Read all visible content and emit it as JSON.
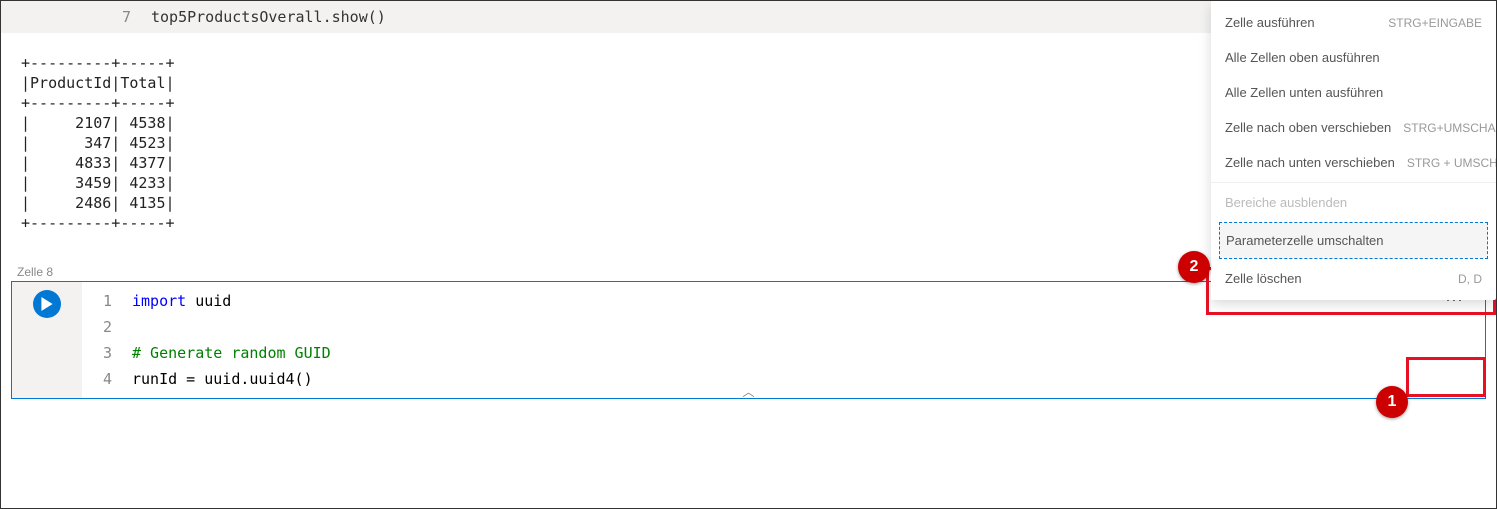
{
  "cell7": {
    "lineno": "7",
    "code": "top5ProductsOverall.show()"
  },
  "output_text": "+---------+-----+\n|ProductId|Total|\n+---------+-----+\n|     2107| 4538|\n|      347| 4523|\n|     4833| 4377|\n|     3459| 4233|\n|     2486| 4135|\n+---------+-----+",
  "cell8_label": "Zelle 8",
  "cell8": {
    "lines": [
      "1",
      "2",
      "3",
      "4"
    ],
    "l1_kw": "import",
    "l1_mod": " uuid",
    "l3_comment": "# Generate random GUID",
    "l4": "runId = uuid.uuid4()"
  },
  "more_icon": "⋯",
  "collapse_icon": "︿",
  "menu": {
    "run_cell": "Zelle ausführen",
    "run_cell_sc": "STRG+EINGABE",
    "run_above": "Alle Zellen oben ausführen",
    "run_below": "Alle Zellen unten ausführen",
    "move_up": "Zelle nach oben verschieben",
    "move_up_sc": "STRG+UMSCHALT",
    "move_down": "Zelle nach unten verschieben",
    "move_down_sc": "STRG + UMSCHALT",
    "hide_ranges": "Bereiche ausblenden",
    "toggle_param": "Parameterzelle  umschalten",
    "delete_cell": "Zelle löschen",
    "delete_cell_sc": "D, D"
  },
  "badges": {
    "one": "1",
    "two": "2"
  }
}
